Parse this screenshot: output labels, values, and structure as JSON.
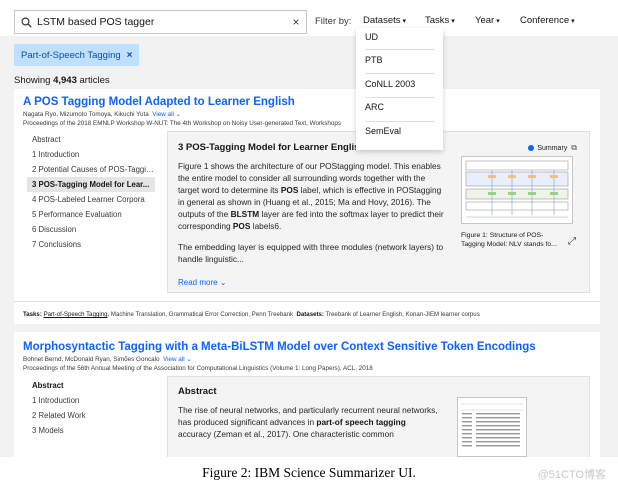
{
  "search": {
    "value": "LSTM based POS tagger",
    "clear_icon": "×"
  },
  "filters": {
    "label": "Filter by:",
    "buttons": [
      "Datasets",
      "Tasks",
      "Year",
      "Conference"
    ],
    "open_dropdown_items": [
      "UD",
      "PTB",
      "CoNLL 2003",
      "ARC",
      "SemEval"
    ]
  },
  "active_chip": {
    "label": "Part-of-Speech Tagging",
    "remove": "×"
  },
  "results": {
    "prefix": "Showing ",
    "count": "4,943",
    "suffix": " articles"
  },
  "articles": [
    {
      "title": "A POS Tagging Model Adapted to Learner English",
      "authors": "Nagata Ryo, Mizumoto Tomoya, Kikuchi Yuta",
      "view_all": "View all",
      "venue": "Proceedings of the 2018 EMNLP Workshop W-NUT: The 4th Workshop on Noisy User-generated Text, Workshops",
      "toc": [
        "Abstract",
        "1 Introduction",
        "2 Potential Causes of POS-Tagging...",
        "3 POS-Tagging Model for Lear...",
        "4 POS-Labeled Learner Corpora",
        "5 Performance Evaluation",
        "6 Discussion",
        "7 Conclusions"
      ],
      "toc_active": 3,
      "section_title": "3 POS-Tagging Model for Learner English",
      "summary_label": "Summary",
      "section_text_1a": "Figure 1 shows the architecture of our POStagging model. This enables the entire model to consider all surrounding words together with the target word to determine its ",
      "section_text_1b": "POS",
      "section_text_1c": " label, which is effective in POStagging in general as shown in (Huang et al., 2015; Ma and Hovy, 2016). The outputs of the ",
      "section_text_1d": "BLSTM",
      "section_text_1e": " layer are fed into the softmax layer to predict their corresponding ",
      "section_text_1f": "POS",
      "section_text_1g": " labels6.",
      "section_text_2": "The embedding layer is equipped with three modules (network layers) to handle linguistic...",
      "read_more": "Read more",
      "figure_caption": "Figure 1: Structure of POS-Tagging Model: NLV stands fo...",
      "tasks_label": "Tasks:",
      "tasks_first": "Part-of-Speech Tagging",
      "tasks_rest": ", Machine Translation, Grammatical Error Correction, Penn Treebank",
      "datasets_label": "Datasets:",
      "datasets": "Treebank of Learner English, Konan-JIEM learner corpus"
    },
    {
      "title": "Morphosyntactic Tagging with a Meta-BiLSTM Model over Context Sensitive Token Encodings",
      "authors": "Bohnet Bernd, McDonald Ryan, Simões Goncalo",
      "view_all": "View all",
      "venue": "Proceedings of the 56th Annual Meeting of the Association for Computational Linguistics (Volume 1: Long Papers), ACL, 2018",
      "toc": [
        "Abstract",
        "1 Introduction",
        "2 Related Work",
        "3 Models"
      ],
      "toc_active": 0,
      "abstract_title": "Abstract",
      "abstract_a": "The rise of neural networks, and particularly recurrent neural networks, has produced significant advances in ",
      "abstract_b": "part-of speech tagging",
      "abstract_c": " accuracy (Zeman et al., 2017). One characteristic common"
    }
  ],
  "caption": "Figure 2: IBM Science Summarizer UI.",
  "watermark": "@51CTO博客",
  "colors": {
    "link": "#0f62fe",
    "chip_bg": "#bfe0ff",
    "page_bg": "#f2f2f2"
  }
}
